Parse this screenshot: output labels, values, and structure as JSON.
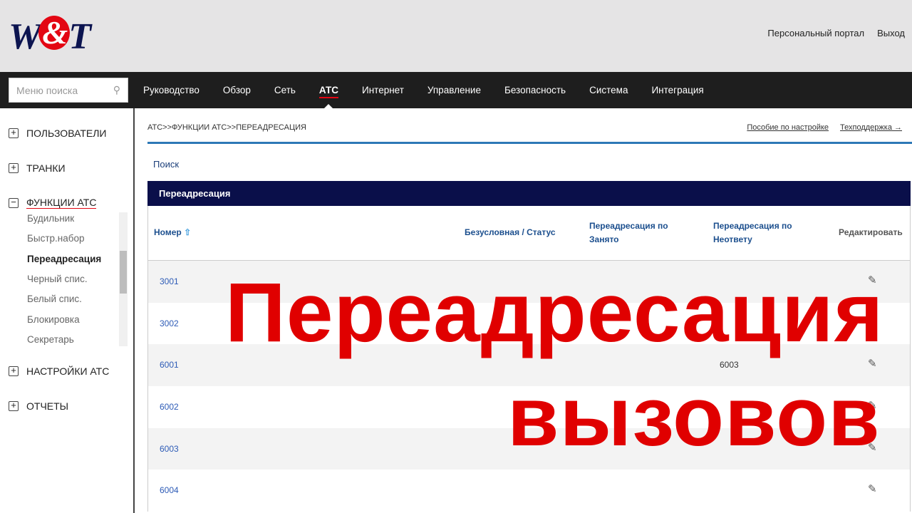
{
  "header": {
    "logo": "W&T",
    "links": [
      "Персональный портал",
      "Выход"
    ]
  },
  "nav": {
    "search_placeholder": "Меню поиска",
    "items": [
      "Руководство",
      "Обзор",
      "Сеть",
      "АТС",
      "Интернет",
      "Управление",
      "Безопасность",
      "Система",
      "Интеграция"
    ],
    "active": "АТС"
  },
  "sidebar": {
    "groups": [
      "ПОЛЬЗОВАТЕЛИ",
      "ТРАНКИ",
      "ФУНКЦИИ АТС",
      "НАСТРОЙКИ АТС",
      "ОТЧЕТЫ"
    ],
    "sub": [
      "Будильник",
      "Быстр.набор",
      "Переадресация",
      "Черный спис.",
      "Белый спис.",
      "Блокировка",
      "Секретарь"
    ]
  },
  "main": {
    "breadcrumb": "АТС>>ФУНКЦИИ АТС>>ПЕРЕАДРЕСАЦИЯ",
    "links": [
      "Пособие по настройке",
      "Техподдержка →"
    ],
    "search_link": "Поиск",
    "panel_title": "Переадресация",
    "columns": [
      "Номер",
      "Безусловная / Статус",
      "Переадресация по Занято",
      "Переадресация по Неответу",
      "Редактировать"
    ],
    "rows": [
      {
        "num": "3001",
        "noanswer": ""
      },
      {
        "num": "3002",
        "noanswer": ""
      },
      {
        "num": "6001",
        "noanswer": "6003"
      },
      {
        "num": "6002",
        "noanswer": ""
      },
      {
        "num": "6003",
        "noanswer": ""
      },
      {
        "num": "6004",
        "noanswer": ""
      }
    ]
  },
  "overlay": {
    "line1": "Переадресация",
    "line2": "вызовов"
  }
}
